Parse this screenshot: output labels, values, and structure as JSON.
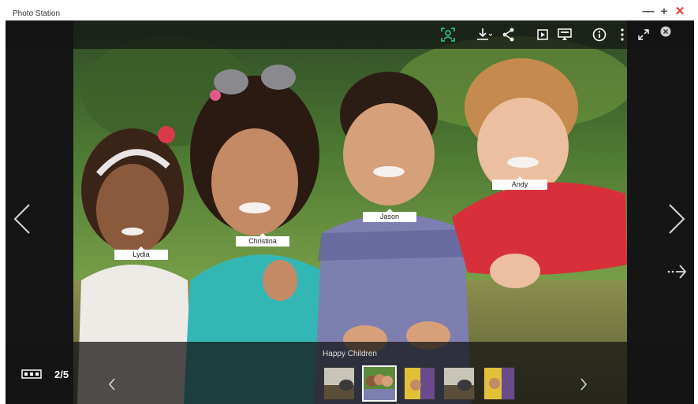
{
  "window": {
    "title": "Photo Station",
    "minimize_glyph": "—",
    "maximize_glyph": "+",
    "close_glyph": "✕"
  },
  "toolbar": {
    "icons": [
      "face-recognition-icon",
      "download-icon",
      "share-icon",
      "slideshow-icon",
      "cast-icon",
      "info-icon",
      "more-icon",
      "fullscreen-icon",
      "close-viewer-icon"
    ],
    "accent_color": "#2bd38a"
  },
  "photo": {
    "face_tags": [
      "Lydia",
      "Christina",
      "Jason",
      "Andy"
    ]
  },
  "bottom": {
    "album_title": "Happy Children",
    "counter": "2/5",
    "thumbnails": [
      {
        "name": "thumbnail-1",
        "active": false
      },
      {
        "name": "thumbnail-2",
        "active": true
      },
      {
        "name": "thumbnail-3",
        "active": false
      },
      {
        "name": "thumbnail-4",
        "active": false
      },
      {
        "name": "thumbnail-5",
        "active": false
      }
    ]
  }
}
